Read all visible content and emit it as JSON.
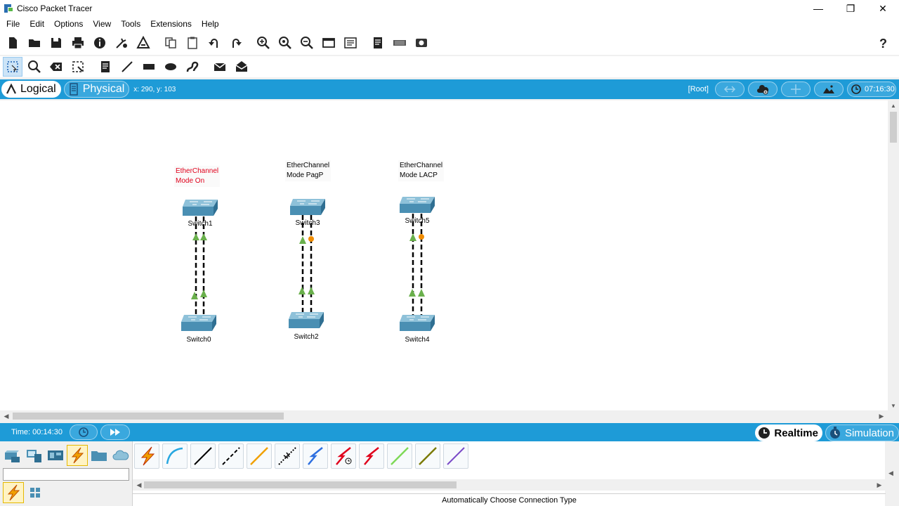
{
  "window": {
    "title": "Cisco Packet Tracer",
    "minimize": "—",
    "maximize": "❐",
    "close": "✕"
  },
  "menu": [
    "File",
    "Edit",
    "Options",
    "View",
    "Tools",
    "Extensions",
    "Help"
  ],
  "toolbar_main": [
    "new-file-icon",
    "open-folder-icon",
    "save-icon",
    "print-icon",
    "info-icon",
    "network-wizard-icon",
    "activity-wizard-icon",
    "copy-icon",
    "paste-icon",
    "undo-icon",
    "redo-icon",
    "zoom-in-icon",
    "zoom-reset-icon",
    "zoom-out-icon",
    "drawing-palette-icon",
    "custom-devices-icon",
    "notes-icon",
    "viewport-icon",
    "screenshot-icon",
    "help-icon"
  ],
  "toolbar_draw": [
    "select-icon",
    "inspect-icon",
    "delete-icon",
    "resize-icon",
    "place-note-icon",
    "draw-line-icon",
    "draw-rectangle-icon",
    "draw-ellipse-icon",
    "freeform-icon",
    "add-simple-pdu-icon",
    "add-complex-pdu-icon"
  ],
  "workspace": {
    "logical_label": "Logical",
    "physical_label": "Physical",
    "coords": "x: 290, y: 103",
    "root_label": "[Root]",
    "clock": "07:16:30"
  },
  "canvas": {
    "notes": [
      {
        "line1": "EtherChannel",
        "line2": "Mode On",
        "color": "#e0001b"
      },
      {
        "line1": "EtherChannel",
        "line2": "Mode PagP",
        "color": "#000000"
      },
      {
        "line1": "EtherChannel",
        "line2": "Mode LACP",
        "color": "#000000"
      }
    ],
    "devices": {
      "switch1": "Switch1",
      "switch0": "Switch0",
      "switch3": "Switch3",
      "switch2": "Switch2",
      "switch5": "Switch5",
      "switch4": "Switch4"
    },
    "link_colors": {
      "up": "#6ab04c",
      "negotiating": "#f08c00",
      "cable": "#000000"
    }
  },
  "timebar": {
    "time": "Time: 00:14:30",
    "realtime_label": "Realtime",
    "simulation_label": "Simulation"
  },
  "bottom": {
    "status": "Automatically Choose Connection Type",
    "cable_colors": {
      "auto": "#f0a000",
      "console": "#27a7e0",
      "straight": "#000000",
      "cross": "#000000",
      "fiber": "#f0a000",
      "phone": "#000000",
      "coax": "#2d6fe0",
      "serial_dce": "#e0001b",
      "serial_dte": "#e0001b",
      "octal": "#7ed957",
      "iot": "#7a7a00",
      "usb": "#7b4bc8"
    }
  }
}
